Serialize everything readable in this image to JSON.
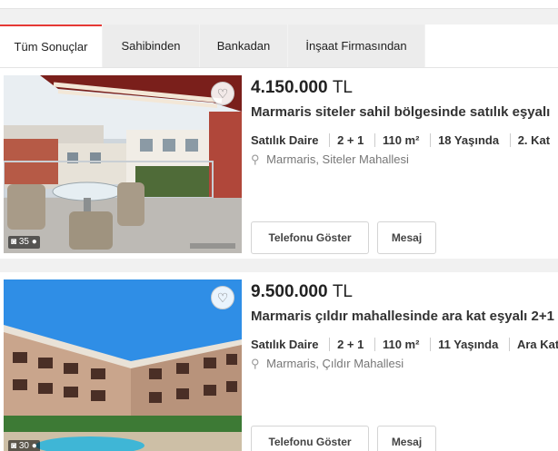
{
  "tabs": [
    {
      "label": "Tüm Sonuçlar",
      "active": true
    },
    {
      "label": "Sahibinden",
      "active": false
    },
    {
      "label": "Bankadan",
      "active": false
    },
    {
      "label": "İnşaat Firmasından",
      "active": false
    }
  ],
  "listings": [
    {
      "price_amount": "4.150.000",
      "currency": "TL",
      "title": "Marmaris siteler sahil bölgesinde satılık eşyalı",
      "features": [
        "Satılık Daire",
        "2 + 1",
        "110 m²",
        "18 Yaşında",
        "2. Kat"
      ],
      "location": "Marmaris, Siteler Mahallesi",
      "photo_count": "35",
      "phone_button": "Telefonu Göster",
      "message_button": "Mesaj",
      "favorite_icon": "heart-outline-icon"
    },
    {
      "price_amount": "9.500.000",
      "currency": "TL",
      "title": "Marmaris çıldır mahallesinde ara kat eşyalı 2+1",
      "features": [
        "Satılık Daire",
        "2 + 1",
        "110 m²",
        "11 Yaşında",
        "Ara Kat"
      ],
      "location": "Marmaris, Çıldır Mahallesi",
      "photo_count": "30",
      "phone_button": "Telefonu Göster",
      "message_button": "Mesaj",
      "favorite_icon": "heart-outline-icon"
    }
  ],
  "colors": {
    "accent": "#e53935",
    "text": "#222222",
    "muted": "#777777"
  }
}
